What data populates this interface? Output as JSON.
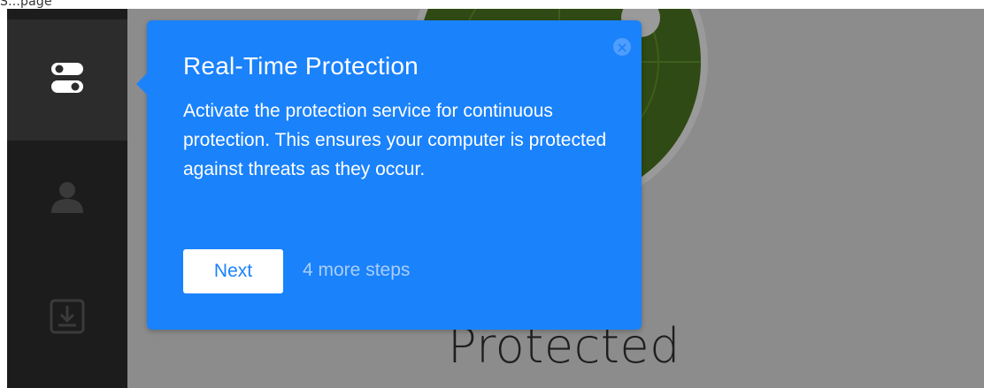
{
  "page": {
    "top_label": "S...page"
  },
  "sidebar": {
    "items": [
      {
        "id": "toggles",
        "icon": "toggle-switches-icon",
        "active": true
      },
      {
        "id": "account",
        "icon": "user-icon",
        "active": false
      },
      {
        "id": "updates",
        "icon": "download-icon",
        "active": false
      }
    ]
  },
  "main": {
    "status_label": "Protected"
  },
  "popover": {
    "title": "Real-Time Protection",
    "body": "Activate the protection service for continuous protection. This ensures your computer is protected against threats as they occur.",
    "next_label": "Next",
    "steps_label": "4 more steps",
    "close_icon": "close-icon"
  },
  "colors": {
    "popover_bg": "#1a82fb",
    "sidebar_bg": "#1c1c1c",
    "main_bg": "#8c8c8c",
    "ring_green": "#2f4a14"
  }
}
